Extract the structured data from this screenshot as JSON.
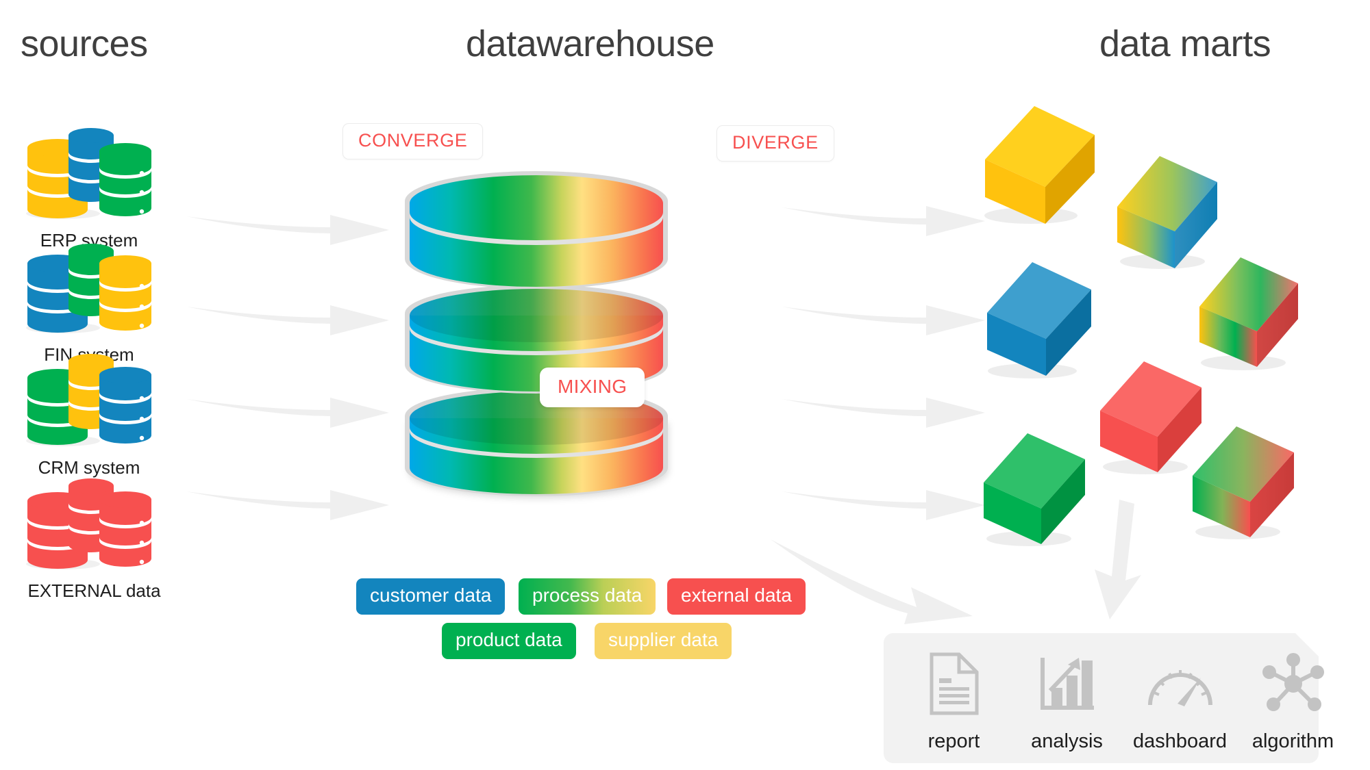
{
  "columns": {
    "sources_title": "sources",
    "warehouse_title": "datawarehouse",
    "marts_title": "data marts"
  },
  "sources": [
    {
      "label": "ERP system",
      "icon": "database-stack-icon",
      "colors": [
        "#FFC20E",
        "#1385BE",
        "#00B050"
      ]
    },
    {
      "label": "FIN system",
      "icon": "database-stack-icon",
      "colors": [
        "#1385BE",
        "#00B050",
        "#FFC20E"
      ]
    },
    {
      "label": "CRM system",
      "icon": "database-stack-icon",
      "colors": [
        "#00B050",
        "#FFC20E",
        "#1385BE"
      ]
    },
    {
      "label": "EXTERNAL data",
      "icon": "database-stack-icon",
      "colors": [
        "#F7504F",
        "#F7504F",
        "#F7504F"
      ]
    }
  ],
  "warehouse": {
    "converge_label": "CONVERGE",
    "diverge_label": "DIVERGE",
    "mixing_label": "MIXING",
    "gradient_stops": [
      "#00A8E8",
      "#00B4A0",
      "#00B050",
      "#9ACB4A",
      "#FFE082",
      "#FBBF5C",
      "#F7504F"
    ],
    "tags": [
      {
        "label": "customer data",
        "color": "#1385BE"
      },
      {
        "label": "process data",
        "color": "#00B050",
        "color2": "#F8D568"
      },
      {
        "label": "external data",
        "color": "#F7504F"
      },
      {
        "label": "product data",
        "color": "#00B050"
      },
      {
        "label": "supplier data",
        "color": "#F8D568"
      }
    ]
  },
  "marts": {
    "cubes": [
      {
        "name": "cube-yellow",
        "colors": [
          "#FFC20E",
          "#FFC20E"
        ]
      },
      {
        "name": "cube-yellow-blue",
        "colors": [
          "#FFC20E",
          "#1385BE"
        ]
      },
      {
        "name": "cube-blue",
        "colors": [
          "#1385BE",
          "#1385BE"
        ]
      },
      {
        "name": "cube-yellow-green-red",
        "colors": [
          "#FFC20E",
          "#00B050",
          "#F7504F"
        ]
      },
      {
        "name": "cube-red",
        "colors": [
          "#F7504F",
          "#F7504F"
        ]
      },
      {
        "name": "cube-green",
        "colors": [
          "#00B050",
          "#00B050"
        ]
      },
      {
        "name": "cube-green-red",
        "colors": [
          "#00B050",
          "#F7504F"
        ]
      }
    ]
  },
  "outputs": [
    {
      "label": "report",
      "icon": "document-icon"
    },
    {
      "label": "analysis",
      "icon": "bar-chart-icon"
    },
    {
      "label": "dashboard",
      "icon": "gauge-icon"
    },
    {
      "label": "algorithm",
      "icon": "network-nodes-icon"
    }
  ],
  "colors": {
    "accent_red": "#F7504F",
    "blue": "#1385BE",
    "green": "#00B050",
    "yellow": "#FFC20E",
    "arrow_gray": "#EFEFEF",
    "panel_gray": "#F2F2F2",
    "icon_gray": "#C3C3C3"
  }
}
